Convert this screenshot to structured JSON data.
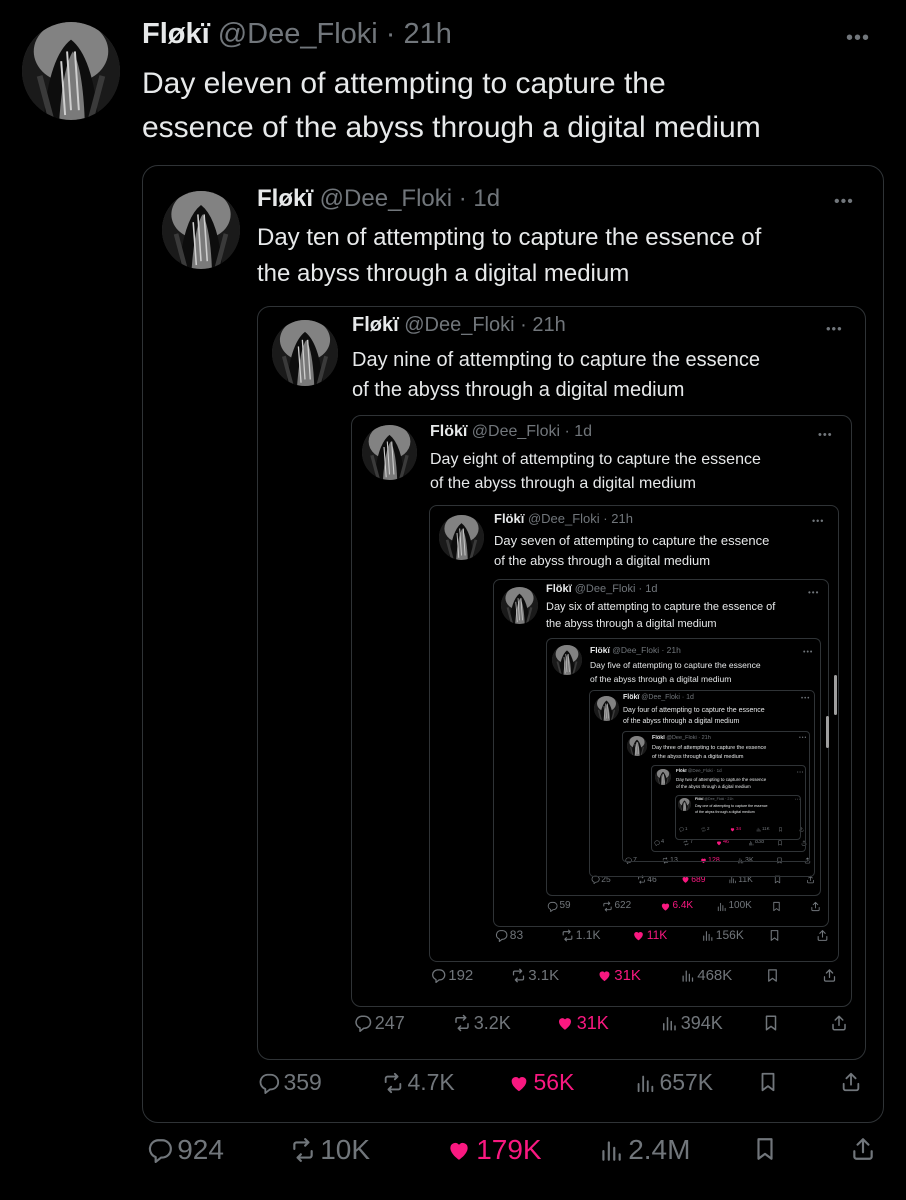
{
  "author": {
    "name": "Fløkï",
    "name_nested": "Flökï",
    "handle": "@Dee_Floki",
    "separator": "·"
  },
  "tweets": [
    {
      "level": 1,
      "time": "21h",
      "text": "Day eleven of attempting to capture the essence of the abyss through a digital medium",
      "line1": "Day eleven of attempting to capture the",
      "line2": "essence of the abyss through a digital medium",
      "replies": "924",
      "reposts": "10K",
      "likes": "179K",
      "views": "2.4M"
    },
    {
      "level": 2,
      "time": "1d",
      "text": "Day ten of attempting to capture the essence of the abyss through a digital medium",
      "line1": "Day ten of attempting to capture the essence of",
      "line2": "the abyss through a digital medium",
      "replies": "359",
      "reposts": "4.7K",
      "likes": "56K",
      "views": "657K"
    },
    {
      "level": 3,
      "time": "21h",
      "text": "Day nine of attempting to capture the essence of the abyss through a digital medium",
      "line1": "Day nine of attempting to capture the essence",
      "line2": "of the abyss through a digital medium",
      "replies": "247",
      "reposts": "3.2K",
      "likes": "31K",
      "views": "394K"
    },
    {
      "level": 4,
      "time": "1d",
      "text": "Day eight of attempting to capture the essence of the abyss through a digital medium",
      "line1": "Day eight of attempting to capture the essence",
      "line2": "of the abyss through a digital medium",
      "replies": "192",
      "reposts": "3.1K",
      "likes": "31K",
      "views": "468K"
    },
    {
      "level": 5,
      "time": "21h",
      "text": "Day seven of attempting to capture the essence of the abyss through a digital medium",
      "line1": "Day seven of attempting to capture the essence",
      "line2": "of the abyss through a digital medium",
      "replies": "83",
      "reposts": "1.1K",
      "likes": "11K",
      "views": "156K"
    },
    {
      "level": 6,
      "time": "1d",
      "text": "Day six of attempting to capture the essence of the abyss through a digital medium",
      "line1": "Day six of attempting to capture the essence of",
      "line2": "the abyss through a digital medium",
      "replies": "59",
      "reposts": "622",
      "likes": "6.4K",
      "views": "100K"
    },
    {
      "level": 7,
      "time": "21h",
      "text": "Day five of attempting to capture the essence of the abyss through a digital medium",
      "line1": "Day five of attempting to capture the essence",
      "line2": "of the abyss through a digital medium",
      "replies": "25",
      "reposts": "46",
      "likes": "689",
      "views": "11K"
    },
    {
      "level": 8,
      "time": "1d",
      "text": "Day four of attempting to capture the essence of the abyss through a digital medium",
      "line1": "Day four of attempting to capture the essence",
      "line2": "of the abyss through a digital medium",
      "replies": "7",
      "reposts": "13",
      "likes": "128",
      "views": "3K"
    },
    {
      "level": 9,
      "time": "21h",
      "text": "Day three of attempting to capture the essence of the abyss through a digital medium",
      "line1": "Day three of attempting to capture the essence",
      "line2": "of the abyss through a digital medium",
      "replies": "4",
      "reposts": "7",
      "likes": "46",
      "views": "838"
    },
    {
      "level": 10,
      "time": "1d",
      "text": "Day two of attempting to capture the essence of the abyss through a digital medium",
      "line1": "Day two of attempting to capture the essence",
      "line2": "of the abyss through a digital medium",
      "replies": "1",
      "reposts": "2",
      "likes": "34",
      "views": "11K"
    },
    {
      "level": 11,
      "time": "21h",
      "text": "Day one of attempting to capture the essence of the abyss through a digital medium",
      "line1": "Day one of attempting to capture the essence",
      "line2": "of the abyss through a digital medium",
      "replies": "",
      "reposts": "",
      "likes": "",
      "views": ""
    }
  ],
  "more_label": "•••",
  "colors": {
    "background": "#000000",
    "text": "#e7e9ea",
    "muted": "#71767b",
    "border": "#2f3336",
    "like": "#f91880"
  },
  "icons": [
    "reply-icon",
    "repost-icon",
    "like-icon",
    "views-icon",
    "bookmark-icon",
    "share-icon"
  ]
}
